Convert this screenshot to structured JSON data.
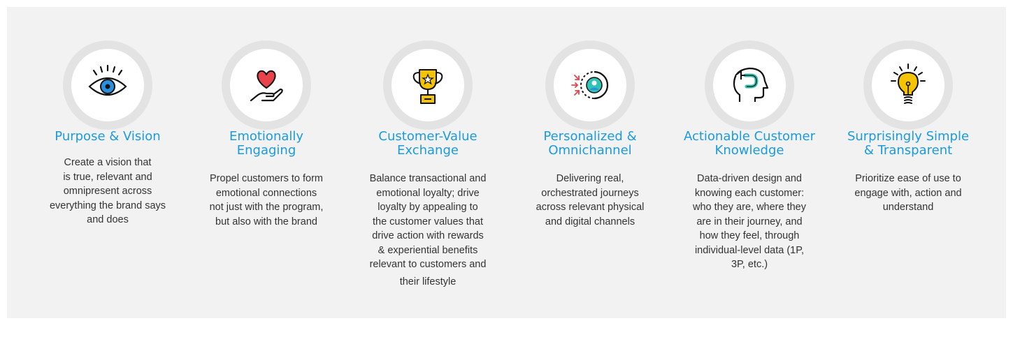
{
  "pillars": [
    {
      "title_lines": [
        "Purpose & Vision"
      ],
      "desc_lines": [
        "Create a vision that",
        "is true, relevant and",
        "omnipresent across",
        "everything the brand says",
        "and does"
      ],
      "icon": "eye-icon"
    },
    {
      "title_lines": [
        "Emotionally",
        "Engaging"
      ],
      "desc_lines": [
        "Propel customers to form",
        "emotional connections",
        "not just with the program,",
        "but also with the brand"
      ],
      "icon": "heart-in-hand-icon"
    },
    {
      "title_lines": [
        "Customer-Value",
        "Exchange"
      ],
      "desc_lines": [
        "Balance transactional and",
        "emotional loyalty; drive",
        "loyalty by appealing to",
        "the customer values that",
        "drive action with rewards",
        "& experiential benefits",
        "relevant to customers and",
        "their lifestyle"
      ],
      "icon": "trophy-icon"
    },
    {
      "title_lines": [
        "Personalized &",
        "Omnichannel"
      ],
      "desc_lines": [
        "Delivering real,",
        "orchestrated journeys",
        "across relevant physical",
        "and digital channels"
      ],
      "icon": "target-person-icon"
    },
    {
      "title_lines": [
        "Actionable Customer",
        "Knowledge"
      ],
      "desc_lines": [
        "Data-driven design and",
        "knowing each customer:",
        "who they are, where they",
        "are in their journey, and",
        "how they feel, through",
        "individual-level data (1P,",
        "3P, etc.)"
      ],
      "icon": "head-insight-icon"
    },
    {
      "title_lines": [
        "Surprisingly Simple",
        "& Transparent"
      ],
      "desc_lines": [
        "Prioritize ease of use to",
        "engage with, action and",
        "understand"
      ],
      "icon": "lightbulb-icon"
    }
  ],
  "colors": {
    "title": "#1a9be0",
    "text": "#333333",
    "panel": "#f2f2f2",
    "accent_red": "#e8424a",
    "accent_yellow": "#f5c400",
    "accent_blue": "#2a8fe0",
    "accent_teal": "#2ec4b6"
  }
}
